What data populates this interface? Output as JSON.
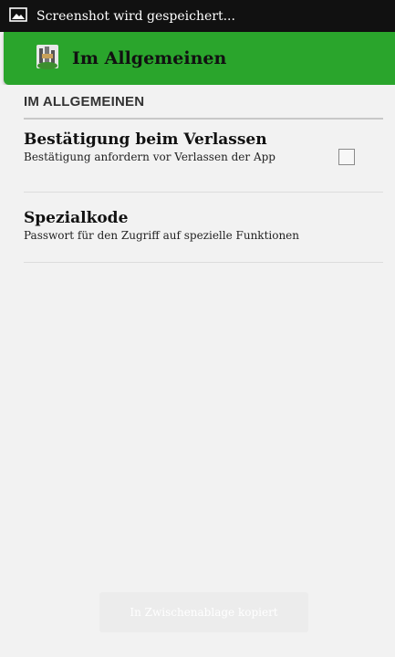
{
  "status_bar": {
    "notification_text": "Screenshot wird gespeichert..."
  },
  "action_bar": {
    "title": "Im Allgemeinen"
  },
  "category": {
    "title": "IM ALLGEMEINEN"
  },
  "preferences": [
    {
      "title": "Bestätigung beim Verlassen",
      "summary": "Bestätigung anfordern vor Verlassen der App",
      "checked": false
    },
    {
      "title": "Spezialkode",
      "summary": "Passwort für den Zugriff auf spezielle Funktionen"
    }
  ],
  "toast": {
    "text": "In Zwischenablage kopiert"
  },
  "colors": {
    "action_bar": "#2aa52c",
    "status_bar": "#111111",
    "background": "#f2f2f2"
  }
}
